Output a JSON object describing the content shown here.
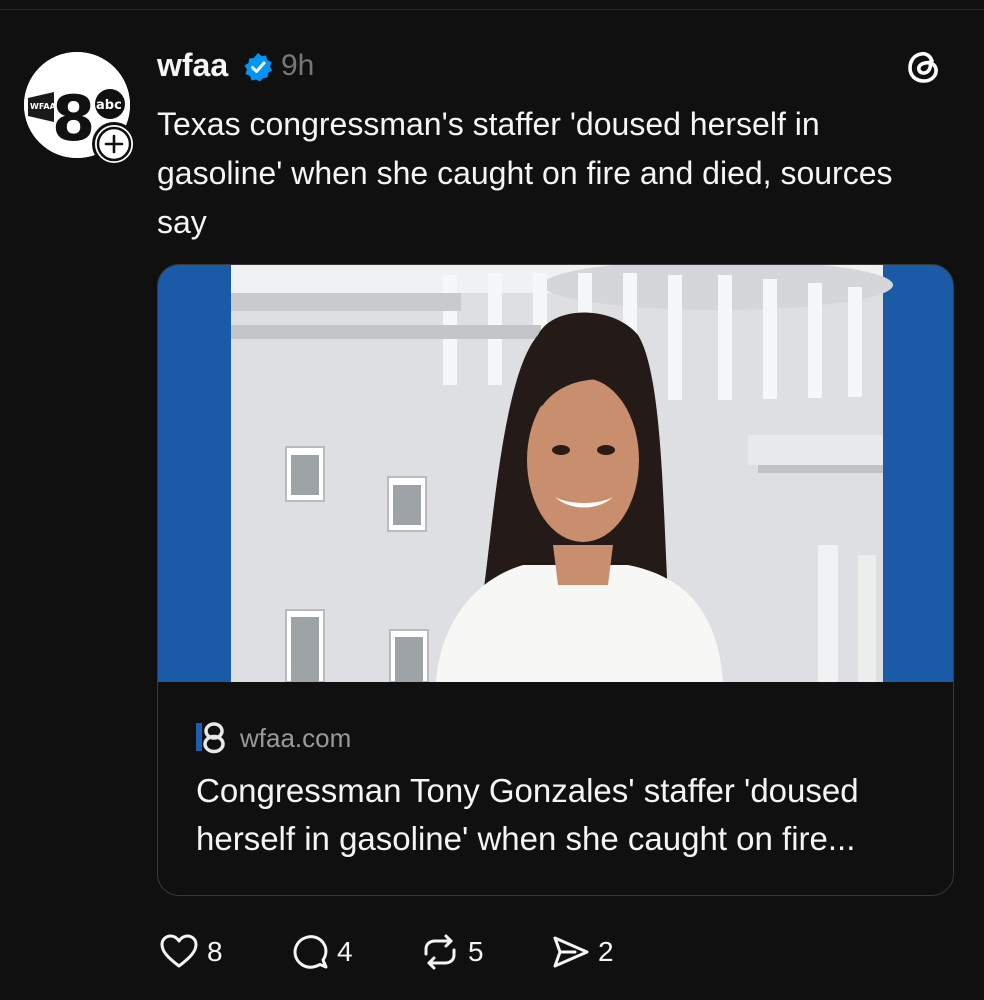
{
  "post": {
    "author": "wfaa",
    "time_ago": "9h",
    "text": "Texas congressman's staffer 'doused herself in gasoline' when she caught on fire and died, sources say",
    "avatar_logo": {
      "station_label": "WFAA",
      "channel": "8",
      "network": "abc"
    }
  },
  "link_card": {
    "domain": "wfaa.com",
    "title": "Congressman Tony Gonzales' staffer 'doused herself in gasoline' when she caught on fire..."
  },
  "actions": {
    "likes": "8",
    "replies": "4",
    "reposts": "5",
    "shares": "2"
  },
  "colors": {
    "background": "#101010",
    "text_primary": "#f3f5f7",
    "text_secondary": "#777777",
    "verified_blue": "#0095f6",
    "card_border": "#3a3a3a",
    "image_side_blue": "#1b5fae"
  },
  "icons": {
    "verified": "verified-badge-icon",
    "app": "threads-logo-icon",
    "like": "heart-icon",
    "reply": "comment-icon",
    "repost": "repost-icon",
    "share": "send-icon",
    "follow": "plus-icon"
  }
}
